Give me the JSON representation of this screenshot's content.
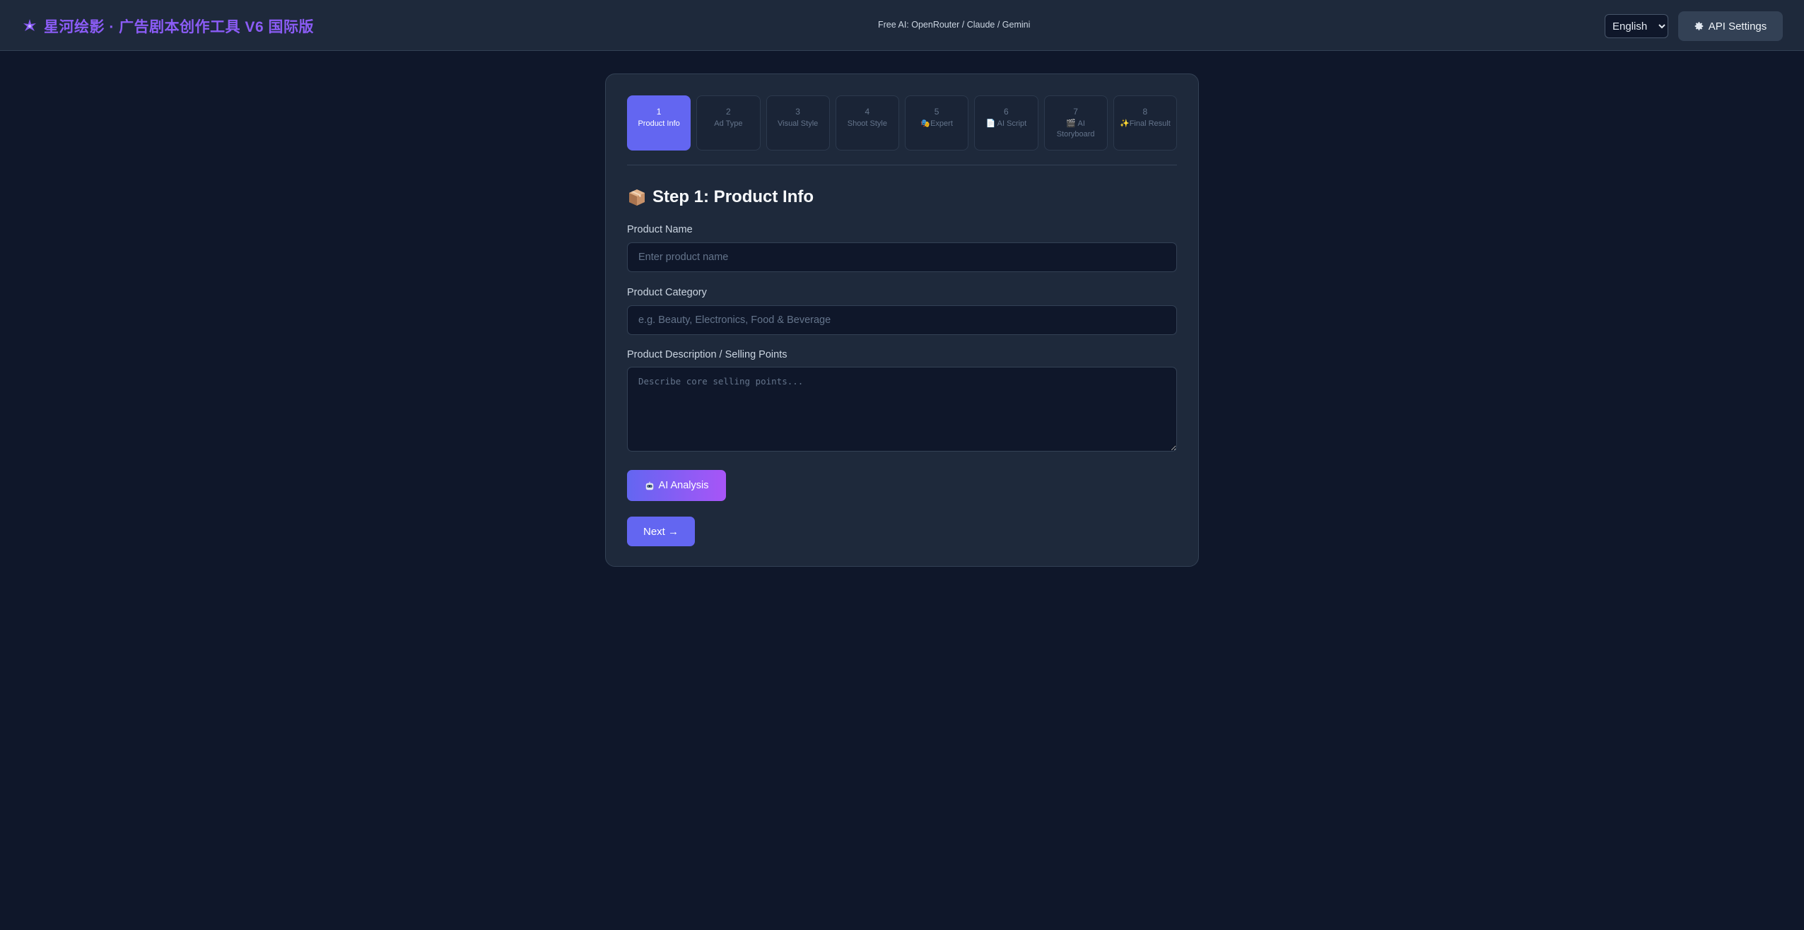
{
  "header": {
    "title": "星河绘影 · 广告剧本创作工具 V6 国际版",
    "brand_icon": "sparkle-star-icon",
    "tagline": "Free AI: OpenRouter / Claude / Gemini",
    "language": {
      "selected": "English"
    },
    "api_settings_label": "API Settings",
    "api_settings_icon": "gear-icon"
  },
  "steps": [
    {
      "number": "1",
      "label": "Product Info",
      "active": true
    },
    {
      "number": "2",
      "label": "Ad Type",
      "active": false
    },
    {
      "number": "3",
      "label": "Visual Style",
      "active": false
    },
    {
      "number": "4",
      "label": "Shoot Style",
      "active": false
    },
    {
      "number": "5",
      "label": "Expert",
      "icon": "masks-icon",
      "active": false
    },
    {
      "number": "6",
      "label": "AI Script",
      "icon": "document-icon",
      "active": false
    },
    {
      "number": "7",
      "label": "AI Storyboard",
      "icon": "clapper-icon",
      "active": false
    },
    {
      "number": "8",
      "label": "Final Result",
      "icon": "sparkles-icon",
      "active": false
    }
  ],
  "form": {
    "heading": "Step 1: Product Info",
    "heading_icon": "package-box-icon",
    "product_name": {
      "label": "Product Name",
      "placeholder": "Enter product name",
      "value": ""
    },
    "product_category": {
      "label": "Product Category",
      "placeholder": "e.g. Beauty, Electronics, Food & Beverage",
      "value": ""
    },
    "product_description": {
      "label": "Product Description / Selling Points",
      "placeholder": "Describe core selling points...",
      "value": ""
    },
    "ai_analysis_label": "AI Analysis",
    "ai_analysis_icon": "robot-icon",
    "next_label": "Next →"
  },
  "colors": {
    "background": "#0f172a",
    "panel": "#1e293b",
    "accent": "#6366f1",
    "accent_purple": "#8b5cf6"
  }
}
